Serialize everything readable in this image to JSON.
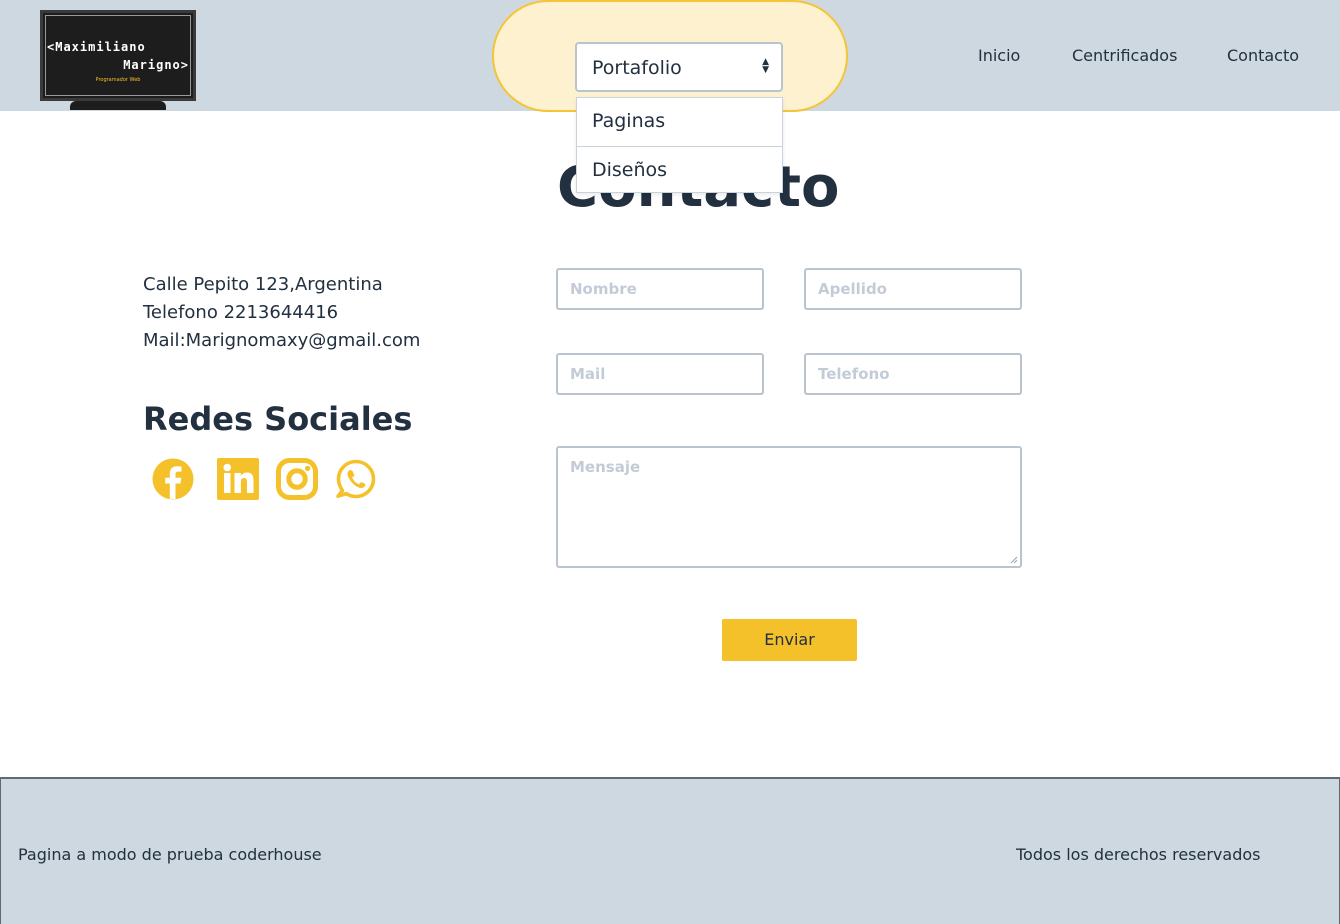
{
  "header": {
    "logo": {
      "line1": "<Maximiliano",
      "line2": "Marigno>",
      "tagline": "Programador Web"
    },
    "portfolio_select": {
      "selected": "Portafolio",
      "options": [
        "Paginas",
        "Diseños"
      ]
    },
    "nav": [
      "Inicio",
      "Centrificados",
      "Contacto"
    ]
  },
  "main": {
    "title": "Contacto",
    "contact_info": [
      "Calle Pepito 123,Argentina",
      "Telefono 2213644416",
      "Mail:Marignomaxy@gmail.com"
    ],
    "social": {
      "title": "Redes Sociales",
      "icons": [
        "facebook-icon",
        "linkedin-icon",
        "instagram-icon",
        "whatsapp-icon"
      ]
    },
    "form": {
      "nombre_placeholder": "Nombre",
      "apellido_placeholder": "Apellido",
      "mail_placeholder": "Mail",
      "telefono_placeholder": "Telefono",
      "mensaje_placeholder": "Mensaje",
      "submit_label": "Enviar"
    }
  },
  "footer": {
    "left": "Pagina a modo de prueba coderhouse",
    "right": "Todos los derechos reservados"
  },
  "colors": {
    "header_bg": "#cdd8e1",
    "accent": "#f5c12a",
    "pill_bg": "#fdf1d0",
    "text": "#22303f",
    "placeholder": "#c3ccd6"
  }
}
